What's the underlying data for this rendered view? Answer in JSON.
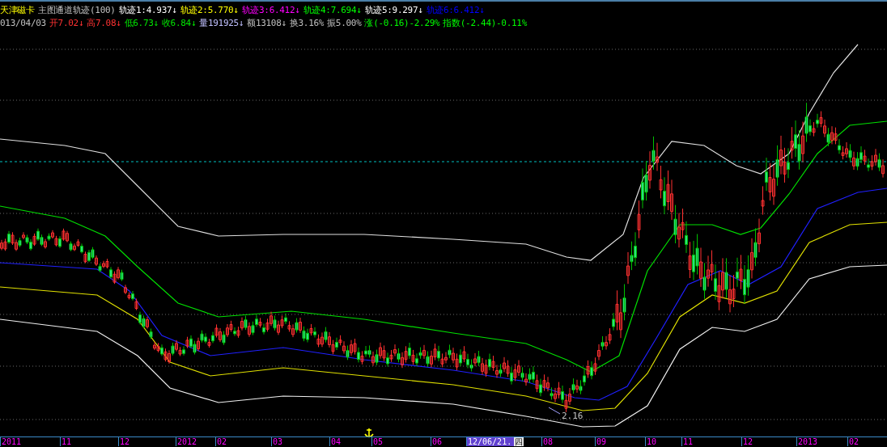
{
  "security": {
    "name": "天津磁卡",
    "indicator": "主图通道轨迹(100)"
  },
  "tracks": [
    {
      "label": "轨迹1:4.937↓",
      "color": "#ffffff"
    },
    {
      "label": "轨迹2:5.770↓",
      "color": "#ffff00"
    },
    {
      "label": "轨迹3:6.412↓",
      "color": "#ff00ff"
    },
    {
      "label": "轨迹4:7.694↓",
      "color": "#00ff00"
    },
    {
      "label": "轨迹5:9.297↓",
      "color": "#ffffff"
    },
    {
      "label": "轨迹6:6.412↓",
      "color": "#0000ff"
    }
  ],
  "quote": {
    "date": "013/04/03",
    "items": [
      {
        "label": "开7.02↓",
        "color": "#ff3232"
      },
      {
        "label": "高7.08↓",
        "color": "#ff3232"
      },
      {
        "label": "低6.73↓",
        "color": "#00e600"
      },
      {
        "label": "收6.84↓",
        "color": "#00e600"
      },
      {
        "label": "量191925↓",
        "color": "#c0c0ff"
      },
      {
        "label": "额13108↓",
        "color": "#c0c0c0"
      },
      {
        "label": "换3.16%",
        "color": "#c0c0c0"
      },
      {
        "label": "振5.00%",
        "color": "#c0c0c0"
      },
      {
        "label": "涨(-0.16)-2.29%",
        "color": "#00ff00"
      },
      {
        "label": "指数(-2.44)-0.11%",
        "color": "#00ff00"
      }
    ]
  },
  "chart": {
    "low_label": "2.16"
  },
  "time_axis": [
    {
      "label": "2011",
      "selected": false
    },
    {
      "label": "11",
      "selected": false
    },
    {
      "label": "12",
      "selected": false
    },
    {
      "label": "2012",
      "selected": false
    },
    {
      "label": "02",
      "selected": false
    },
    {
      "label": "03",
      "selected": false
    },
    {
      "label": "04",
      "selected": false
    },
    {
      "label": "05",
      "selected": false
    },
    {
      "label": "06",
      "selected": false
    },
    {
      "label": "12/06/21.",
      "weekday": "四",
      "selected": true
    },
    {
      "label": "08",
      "selected": false
    },
    {
      "label": "09",
      "selected": false
    },
    {
      "label": "10",
      "selected": false
    },
    {
      "label": "11",
      "selected": false
    },
    {
      "label": "12",
      "selected": false
    },
    {
      "label": "2013",
      "selected": false
    },
    {
      "label": "02",
      "selected": false
    }
  ]
}
